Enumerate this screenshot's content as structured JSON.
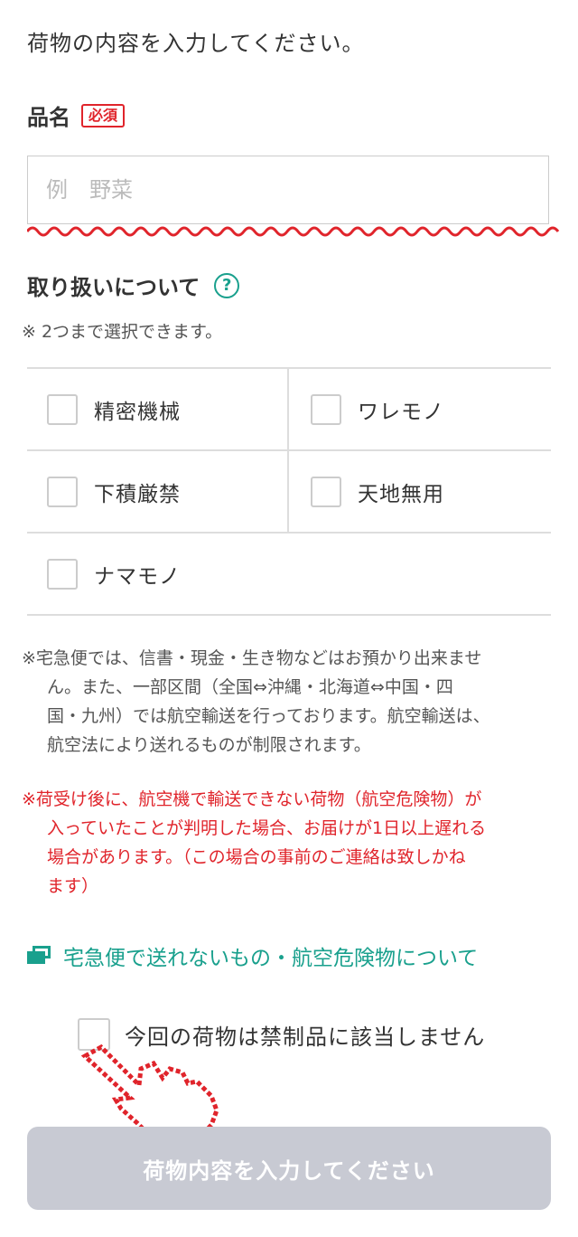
{
  "intro": "荷物の内容を入力してください。",
  "item_name": {
    "label": "品名",
    "required_badge": "必須",
    "placeholder": "例　野菜"
  },
  "handling": {
    "title": "取り扱いについて",
    "help_icon": "question-circle-icon",
    "note": "※ 2つまで選択できます。",
    "options": [
      {
        "label": "精密機械",
        "checked": false
      },
      {
        "label": "ワレモノ",
        "checked": false
      },
      {
        "label": "下積厳禁",
        "checked": false
      },
      {
        "label": "天地無用",
        "checked": false
      },
      {
        "label": "ナマモノ",
        "checked": false
      }
    ]
  },
  "notice": {
    "line1": "※宅急便では、信書・現金・生き物などはお預かり出来ませ",
    "line2": "ん。また、一部区間（全国⇔沖縄・北海道⇔中国・四",
    "line3": "国・九州）では航空輸送を行っております。航空輸送は、",
    "line4": "航空法により送れるものが制限されます。"
  },
  "warning": {
    "line1": "※荷受け後に、航空機で輸送できない荷物（航空危険物）が",
    "line2": "入っていたことが判明した場合、お届けが1日以上遅れる",
    "line3": "場合があります。（この場合の事前のご連絡は致しかね",
    "line4": "ます）"
  },
  "link": {
    "label": "宅急便で送れないもの・航空危険物について",
    "icon": "external-window-icon"
  },
  "confirm": {
    "label": "今回の荷物は禁制品に該当しません",
    "checked": false
  },
  "submit_label": "荷物内容を入力してください",
  "colors": {
    "accent": "#19a08d",
    "required": "#e0242b",
    "button_disabled": "#c8cad3"
  }
}
